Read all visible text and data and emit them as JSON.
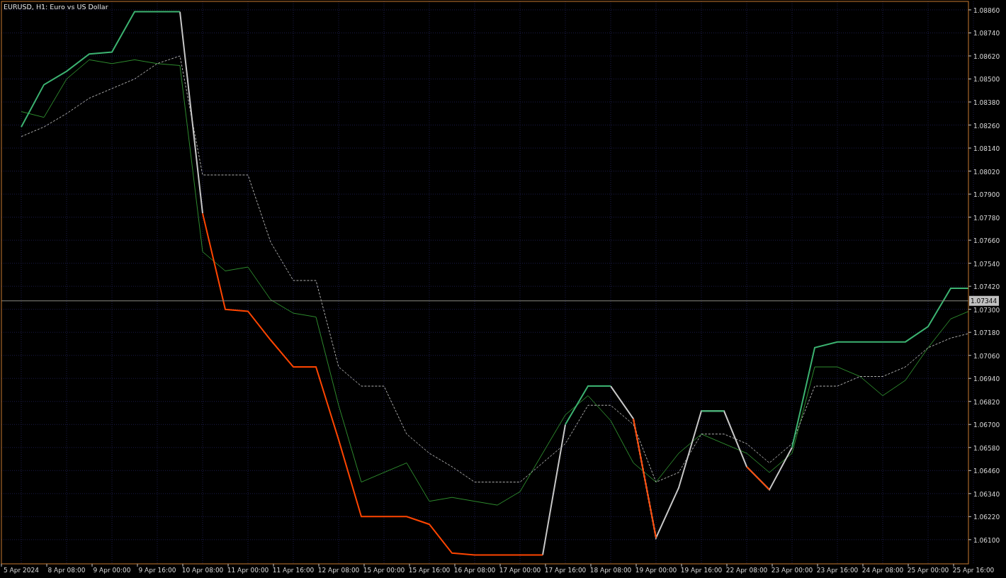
{
  "chart": {
    "chart_data": {
      "type": "line",
      "title": "EURUSD, H1: Euro vs US Dollar",
      "grid": true,
      "categories": [
        "5 Apr 2024",
        null,
        "8 Apr 08:00",
        null,
        "9 Apr 00:00",
        null,
        "9 Apr 16:00",
        null,
        "10 Apr 08:00",
        null,
        "11 Apr 00:00",
        null,
        "11 Apr 16:00",
        null,
        "12 Apr 08:00",
        null,
        "15 Apr 00:00",
        null,
        "15 Apr 16:00",
        null,
        "16 Apr 08:00",
        null,
        "17 Apr 00:00",
        null,
        "17 Apr 16:00",
        null,
        "18 Apr 08:00",
        null,
        "19 Apr 00:00",
        null,
        "19 Apr 16:00",
        null,
        "22 Apr 08:00",
        null,
        "23 Apr 00:00",
        null,
        "23 Apr 16:00",
        null,
        "24 Apr 08:00",
        null,
        "25 Apr 00:00",
        null,
        "25 Apr 16:00"
      ],
      "series": [
        {
          "color": "#2e8b2e",
          "line_style": "solid",
          "values": [
            1.0833,
            1.083,
            1.085,
            1.086,
            1.0858,
            1.086,
            1.0858,
            1.0857,
            1.076,
            1.075,
            1.0752,
            1.0735,
            1.0728,
            1.0726,
            1.068,
            1.064,
            1.0645,
            1.065,
            1.063,
            1.0632,
            1.063,
            1.0628,
            1.0635,
            1.0655,
            1.0675,
            1.0685,
            1.0672,
            1.065,
            1.064,
            1.0655,
            1.0665,
            1.066,
            1.0655,
            1.0645,
            1.0655,
            1.07,
            1.07,
            1.0695,
            1.0685,
            1.0693,
            1.071,
            1.0725,
            1.073
          ]
        },
        {
          "color": "#b0b0b0",
          "line_style": "dashed",
          "values": [
            1.082,
            1.0825,
            1.0832,
            1.084,
            1.0845,
            1.085,
            1.0858,
            1.0862,
            1.08,
            1.08,
            1.08,
            1.0765,
            1.0745,
            1.0745,
            1.07,
            1.069,
            1.069,
            1.0665,
            1.0655,
            1.0648,
            1.064,
            1.064,
            1.064,
            1.065,
            1.066,
            1.068,
            1.068,
            1.067,
            1.064,
            1.0645,
            1.0665,
            1.0665,
            1.066,
            1.065,
            1.066,
            1.069,
            1.069,
            1.0695,
            1.0695,
            1.07,
            1.071,
            1.0715,
            1.0718
          ]
        },
        {
          "color": "#c8c8c8",
          "line_style": "solid",
          "values": [
            null,
            null,
            null,
            null,
            null,
            null,
            null,
            1.0885,
            1.078,
            null,
            null,
            null,
            null,
            null,
            null,
            null,
            null,
            null,
            null,
            null,
            null,
            null,
            null,
            1.0602,
            1.067,
            null,
            1.069,
            1.0673,
            1.0611,
            1.0637,
            1.0677,
            1.0677,
            1.0648,
            1.0636,
            1.0658,
            null,
            null,
            null,
            null,
            null,
            null,
            null,
            null
          ]
        },
        {
          "color": "#ff4500",
          "line_style": "solid",
          "values": [
            null,
            null,
            null,
            null,
            null,
            null,
            null,
            null,
            1.078,
            1.073,
            1.0729,
            1.0714,
            1.07,
            1.07,
            1.0662,
            1.0622,
            1.0622,
            1.0622,
            1.0618,
            1.0603,
            1.0602,
            1.0602,
            1.0602,
            1.0602,
            null,
            null,
            null,
            1.0673,
            1.0611,
            null,
            null,
            null,
            1.0648,
            1.0636,
            null,
            null,
            null,
            null,
            null,
            null,
            null,
            null,
            null
          ]
        },
        {
          "color": "#3cb371",
          "line_style": "solid",
          "values": [
            1.0825,
            1.0847,
            1.0854,
            1.0863,
            1.0864,
            1.0885,
            1.0885,
            1.0885,
            null,
            null,
            null,
            null,
            null,
            null,
            null,
            null,
            null,
            null,
            null,
            null,
            null,
            null,
            null,
            null,
            1.067,
            1.069,
            1.069,
            null,
            null,
            null,
            1.0677,
            1.0677,
            null,
            null,
            1.0658,
            1.071,
            1.0713,
            1.0713,
            1.0713,
            1.0713,
            1.0721,
            1.0741,
            1.0741
          ]
        }
      ],
      "ylim": [
        1.05974,
        1.08904
      ],
      "yticks": [
        {
          "value": 1.0886,
          "label": "1.08860"
        },
        {
          "value": 1.0874,
          "label": "1.08740"
        },
        {
          "value": 1.0862,
          "label": "1.08620"
        },
        {
          "value": 1.085,
          "label": "1.08500"
        },
        {
          "value": 1.0838,
          "label": "1.08380"
        },
        {
          "value": 1.0826,
          "label": "1.08260"
        },
        {
          "value": 1.0814,
          "label": "1.08140"
        },
        {
          "value": 1.0802,
          "label": "1.08020"
        },
        {
          "value": 1.079,
          "label": "1.07900"
        },
        {
          "value": 1.0778,
          "label": "1.07780"
        },
        {
          "value": 1.0766,
          "label": "1.07660"
        },
        {
          "value": 1.0754,
          "label": "1.07540"
        },
        {
          "value": 1.0742,
          "label": "1.07420"
        },
        {
          "value": 1.073,
          "label": "1.07300"
        },
        {
          "value": 1.0718,
          "label": "1.07180"
        },
        {
          "value": 1.0706,
          "label": "1.07060"
        },
        {
          "value": 1.0694,
          "label": "1.06940"
        },
        {
          "value": 1.0682,
          "label": "1.06820"
        },
        {
          "value": 1.067,
          "label": "1.06700"
        },
        {
          "value": 1.0658,
          "label": "1.06580"
        },
        {
          "value": 1.0646,
          "label": "1.06460"
        },
        {
          "value": 1.0634,
          "label": "1.06340"
        },
        {
          "value": 1.0622,
          "label": "1.06220"
        },
        {
          "value": 1.061,
          "label": "1.06100"
        }
      ],
      "ref_lines": [
        {
          "axis": "y",
          "value": 1.07344,
          "label": "1.07344",
          "color": "#8a8a80"
        }
      ]
    }
  }
}
